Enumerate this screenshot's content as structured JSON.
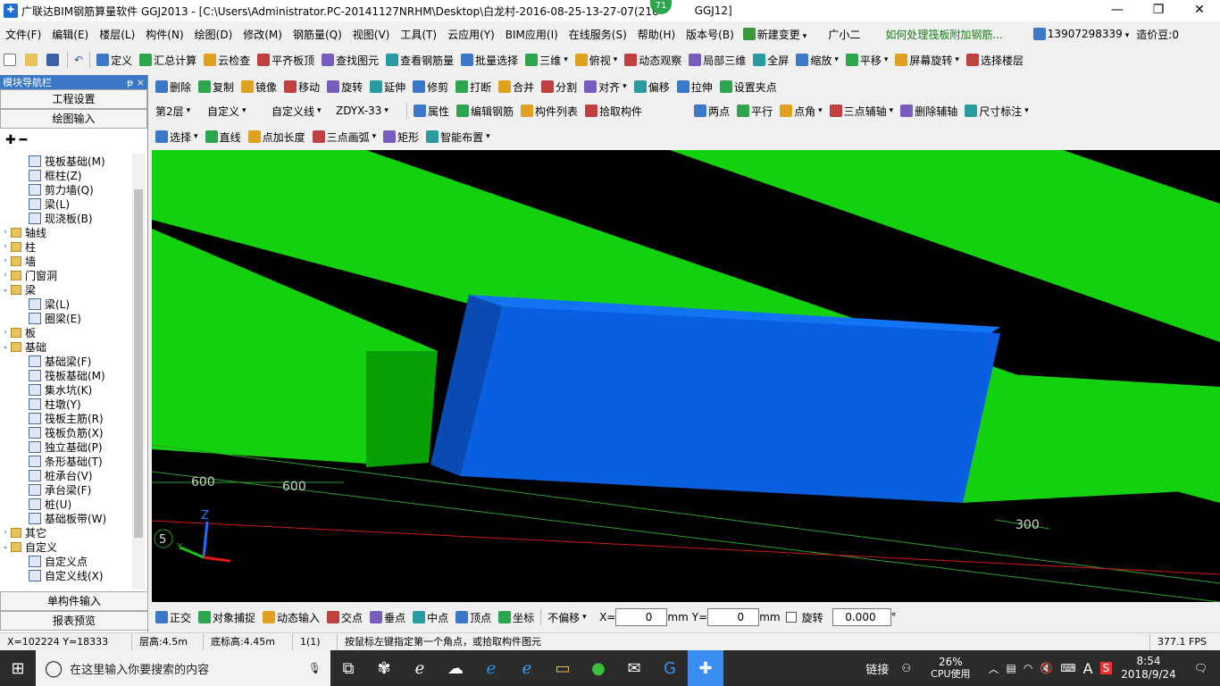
{
  "title": {
    "app": "广联达BIM钢筋算量软件 GGJ2013 - [C:\\Users\\Administrator.PC-20141127NRHM\\Desktop\\白龙村-2016-08-25-13-27-07(216",
    "app_tail": "GGJ12]",
    "badge": "71",
    "minimize": "—",
    "restore": "❐",
    "close": "✕"
  },
  "menu": [
    "文件(F)",
    "编辑(E)",
    "楼层(L)",
    "构件(N)",
    "绘图(D)",
    "修改(M)",
    "钢筋量(Q)",
    "视图(V)",
    "工具(T)",
    "云应用(Y)",
    "BIM应用(I)",
    "在线服务(S)",
    "帮助(H)",
    "版本号(B)"
  ],
  "menu_extra": {
    "new_change": "新建变更",
    "assistant": "广小二",
    "question": "如何处理筏板附加钢筋...",
    "phone": "13907298339",
    "beans": "造价豆:0"
  },
  "toolbar1": [
    "定义",
    "汇总计算",
    "云检查",
    "平齐板顶",
    "查找图元",
    "查看钢筋量",
    "批量选择",
    "三维",
    "俯视",
    "动态观察",
    "局部三维",
    "全屏",
    "缩放",
    "平移",
    "屏幕旋转",
    "选择楼层"
  ],
  "toolbar2": [
    "删除",
    "复制",
    "镜像",
    "移动",
    "旋转",
    "延伸",
    "修剪",
    "打断",
    "合并",
    "分割",
    "对齐",
    "偏移",
    "拉伸",
    "设置夹点"
  ],
  "toolbar3": {
    "floor": "第2层",
    "type": "自定义",
    "subtype": "自定义线",
    "name": "ZDYX-33",
    "items": [
      "属性",
      "编辑钢筋",
      "构件列表",
      "拾取构件"
    ],
    "axis_items": [
      "两点",
      "平行",
      "点角",
      "三点辅轴",
      "删除辅轴",
      "尺寸标注"
    ]
  },
  "toolbar4": [
    "选择",
    "直线",
    "点加长度",
    "三点画弧",
    "矩形",
    "智能布置"
  ],
  "nav": {
    "header": "模块导航栏",
    "pin": "ᵽ",
    "close": "×",
    "project_settings": "工程设置",
    "drawing_input": "绘图输入",
    "single_input": "单构件输入",
    "report_preview": "报表预览"
  },
  "tree": [
    {
      "label": "筏板基础(M)",
      "kind": "child"
    },
    {
      "label": "框柱(Z)",
      "kind": "child"
    },
    {
      "label": "剪力墙(Q)",
      "kind": "child"
    },
    {
      "label": "梁(L)",
      "kind": "child"
    },
    {
      "label": "现浇板(B)",
      "kind": "child"
    },
    {
      "label": "轴线",
      "kind": "folder",
      "toggle": "›"
    },
    {
      "label": "柱",
      "kind": "folder",
      "toggle": "›"
    },
    {
      "label": "墙",
      "kind": "folder",
      "toggle": "›"
    },
    {
      "label": "门窗洞",
      "kind": "folder",
      "toggle": "›"
    },
    {
      "label": "梁",
      "kind": "folder",
      "toggle": "⌄"
    },
    {
      "label": "梁(L)",
      "kind": "child"
    },
    {
      "label": "圈梁(E)",
      "kind": "child"
    },
    {
      "label": "板",
      "kind": "folder",
      "toggle": "›"
    },
    {
      "label": "基础",
      "kind": "folder",
      "toggle": "⌄"
    },
    {
      "label": "基础梁(F)",
      "kind": "child"
    },
    {
      "label": "筏板基础(M)",
      "kind": "child"
    },
    {
      "label": "集水坑(K)",
      "kind": "child"
    },
    {
      "label": "柱墩(Y)",
      "kind": "child"
    },
    {
      "label": "筏板主筋(R)",
      "kind": "child"
    },
    {
      "label": "筏板负筋(X)",
      "kind": "child"
    },
    {
      "label": "独立基础(P)",
      "kind": "child"
    },
    {
      "label": "条形基础(T)",
      "kind": "child"
    },
    {
      "label": "桩承台(V)",
      "kind": "child"
    },
    {
      "label": "承台梁(F)",
      "kind": "child"
    },
    {
      "label": "桩(U)",
      "kind": "child"
    },
    {
      "label": "基础板带(W)",
      "kind": "child"
    },
    {
      "label": "其它",
      "kind": "folder",
      "toggle": "›"
    },
    {
      "label": "自定义",
      "kind": "folder",
      "toggle": "⌄"
    },
    {
      "label": "自定义点",
      "kind": "child"
    },
    {
      "label": "自定义线(X)",
      "kind": "child"
    }
  ],
  "viewport": {
    "dims": [
      "600",
      "600",
      "300"
    ],
    "axis_z": "Z",
    "axis_y": "Y",
    "axis_label": "5",
    "colors": {
      "beam": "#13d10e",
      "beam_dark": "#0a9e07",
      "block": "#0a5fe0",
      "block_side": "#0a4bb3",
      "block_top": "#1273f5"
    }
  },
  "snap": {
    "items": [
      "正交",
      "对象捕捉",
      "动态输入",
      "交点",
      "垂点",
      "中点",
      "顶点",
      "坐标"
    ],
    "offset_mode": "不偏移",
    "x_label": "X=",
    "x_value": "0",
    "x_unit": "mm",
    "y_label": "Y=",
    "y_value": "0",
    "y_unit": "mm",
    "rotate_label": "旋转",
    "rotate_value": "0.000",
    "deg": "°"
  },
  "status": {
    "coords": "X=102224 Y=18333",
    "floor_height": "层高:4.5m",
    "bottom_height": "底标高:4.45m",
    "count": "1(1)",
    "hint": "按鼠标左键指定第一个角点，或拾取构件图元",
    "fps": "377.1 FPS"
  },
  "taskbar": {
    "search_placeholder": "在这里输入你要搜索的内容",
    "link": "链接",
    "cpu_pct": "26%",
    "cpu_label": "CPU使用",
    "time": "8:54",
    "date": "2018/9/24"
  }
}
